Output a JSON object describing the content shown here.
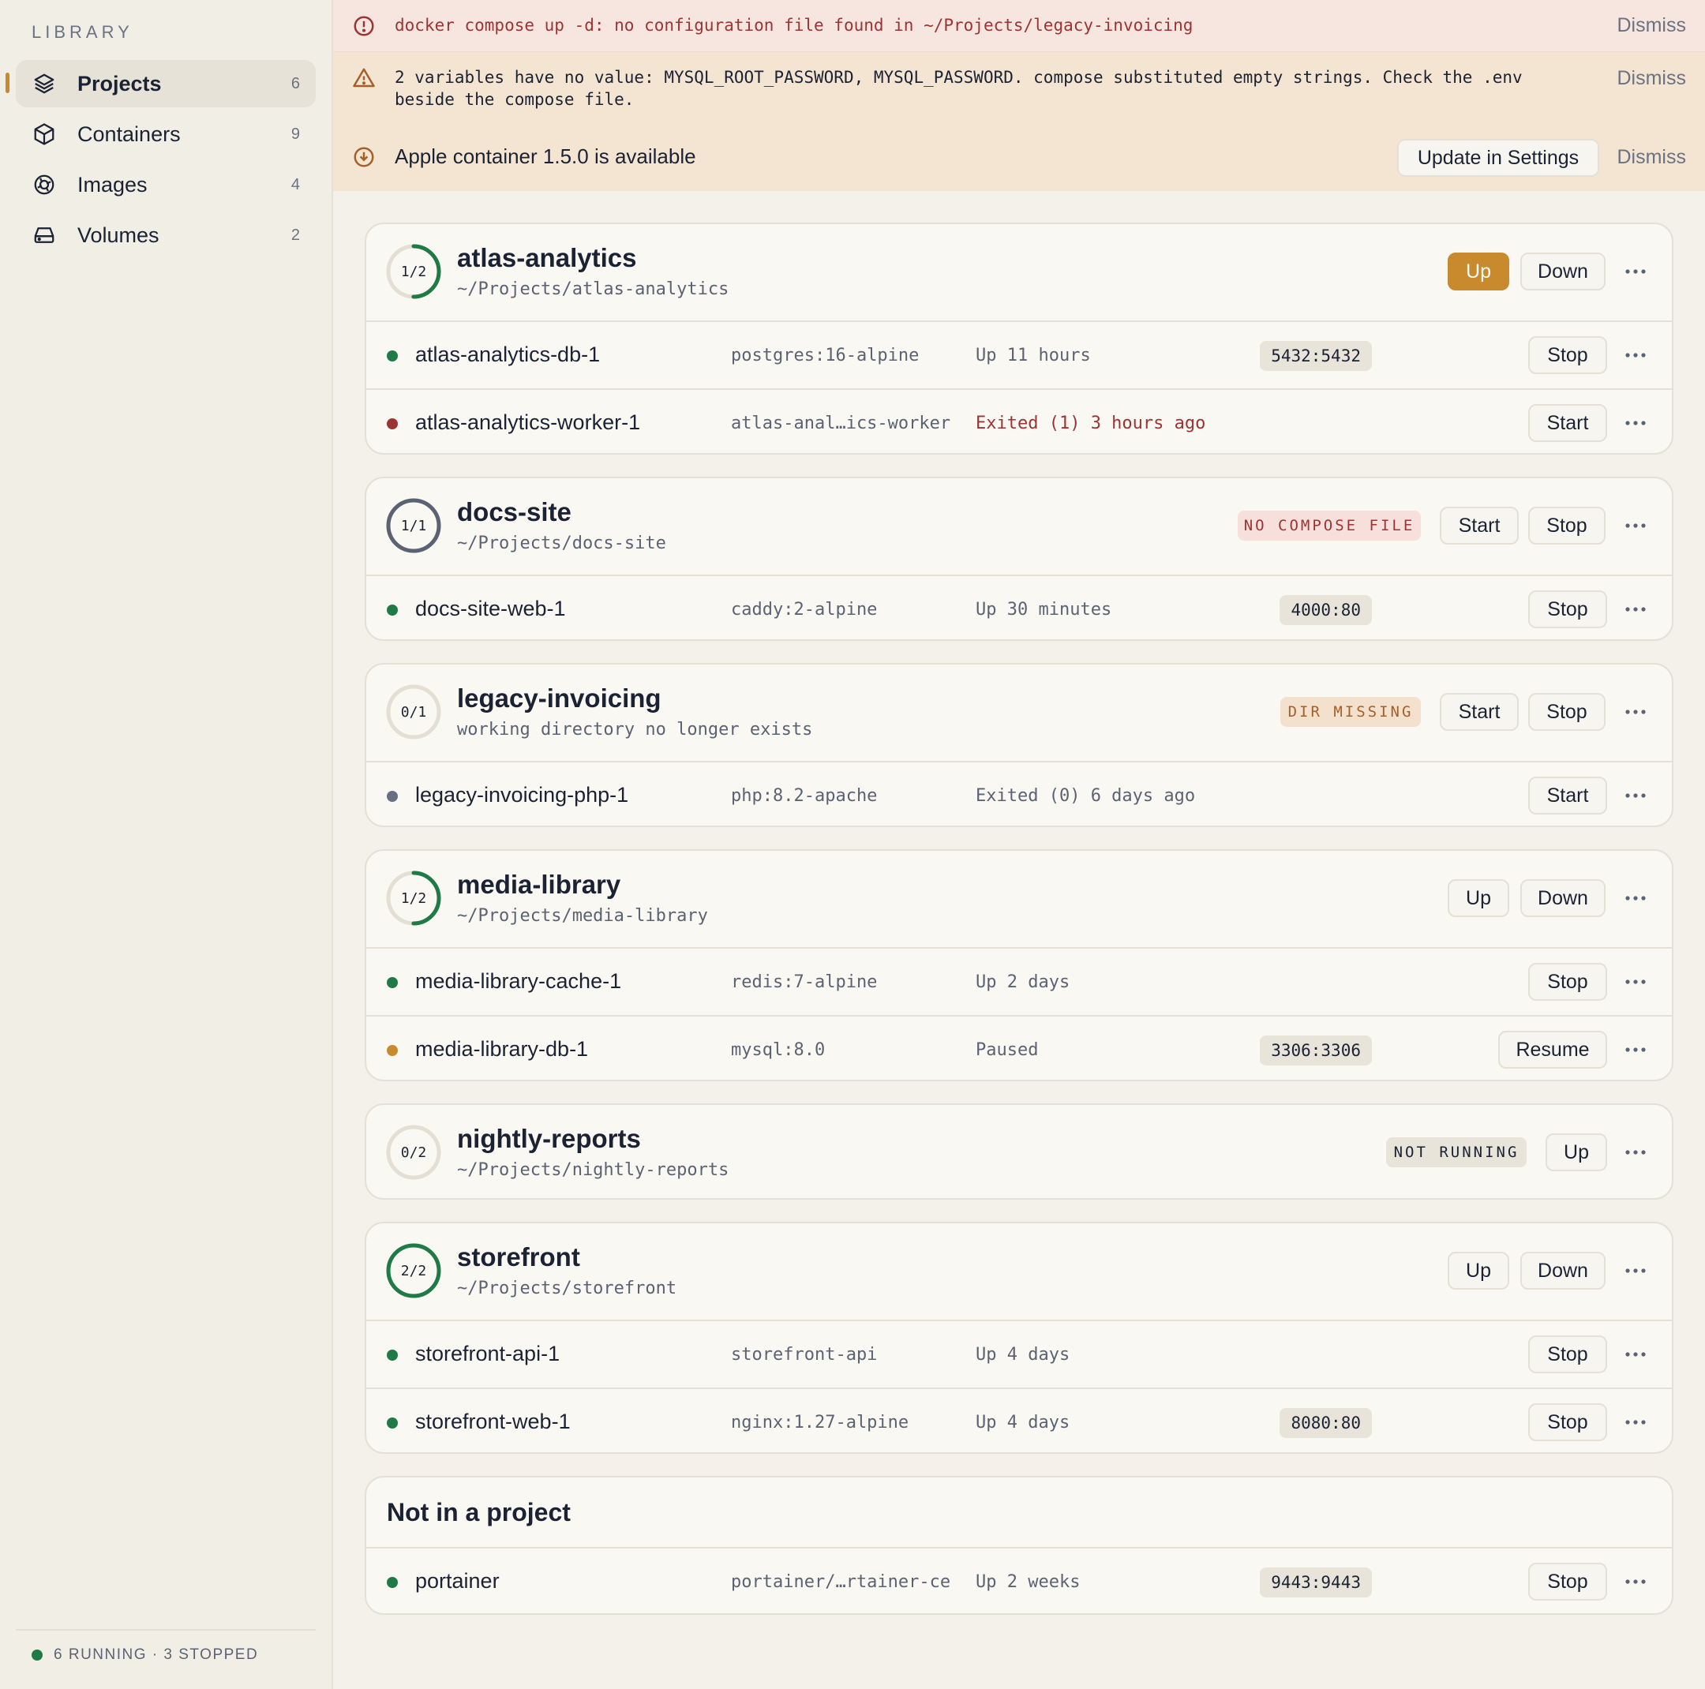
{
  "sidebar": {
    "heading": "LIBRARY",
    "items": [
      {
        "label": "Projects",
        "count": "6",
        "icon": "layers-icon"
      },
      {
        "label": "Containers",
        "count": "9",
        "icon": "box-icon"
      },
      {
        "label": "Images",
        "count": "4",
        "icon": "disc-icon"
      },
      {
        "label": "Volumes",
        "count": "2",
        "icon": "drive-icon"
      }
    ],
    "status": "6 RUNNING · 3 STOPPED"
  },
  "banners": {
    "error": {
      "text": "docker compose up -d: no configuration file found in ~/Projects/legacy-invoicing",
      "dismiss": "Dismiss"
    },
    "warning": {
      "text_line1": "2 variables have no value: MYSQL_ROOT_PASSWORD, MYSQL_PASSWORD. compose substituted empty strings. Check the .env",
      "text_line2": "beside the compose file.",
      "dismiss": "Dismiss"
    },
    "update": {
      "text": "Apple container 1.5.0 is available",
      "action": "Update in Settings",
      "dismiss": "Dismiss"
    }
  },
  "colors": {
    "accent": "#c98a2d",
    "running": "#1f7a46",
    "exited_error": "#9c3434",
    "stopped": "#667085",
    "paused": "#c98a2d"
  },
  "projects": [
    {
      "name": "atlas-analytics",
      "path": "~/Projects/atlas-analytics",
      "ratio": "1/2",
      "running_fraction": 0.5,
      "buttons": [
        "Up",
        "Down"
      ],
      "containers": [
        {
          "name": "atlas-analytics-db-1",
          "image": "postgres:16-alpine",
          "status": "Up 11 hours",
          "port": "5432:5432",
          "action": "Stop",
          "state": "running"
        },
        {
          "name": "atlas-analytics-worker-1",
          "image": "atlas-anal…ics-worker",
          "status": "Exited (1) 3 hours ago",
          "port": "",
          "action": "Start",
          "state": "error"
        }
      ]
    },
    {
      "name": "docs-site",
      "path": "~/Projects/docs-site",
      "ratio": "1/1",
      "running_fraction": 1.0,
      "badge": "NO COMPOSE FILE",
      "buttons": [
        "Start",
        "Stop"
      ],
      "containers": [
        {
          "name": "docs-site-web-1",
          "image": "caddy:2-alpine",
          "status": "Up 30 minutes",
          "port": "4000:80",
          "action": "Stop",
          "state": "running"
        }
      ]
    },
    {
      "name": "legacy-invoicing",
      "path": "working directory no longer exists",
      "ratio": "0/1",
      "running_fraction": 0,
      "badge": "DIR MISSING",
      "buttons": [
        "Start",
        "Stop"
      ],
      "containers": [
        {
          "name": "legacy-invoicing-php-1",
          "image": "php:8.2-apache",
          "status": "Exited (0) 6 days ago",
          "port": "",
          "action": "Start",
          "state": "stopped"
        }
      ]
    },
    {
      "name": "media-library",
      "path": "~/Projects/media-library",
      "ratio": "1/2",
      "running_fraction": 0.5,
      "buttons": [
        "Up",
        "Down"
      ],
      "containers": [
        {
          "name": "media-library-cache-1",
          "image": "redis:7-alpine",
          "status": "Up 2 days",
          "port": "",
          "action": "Stop",
          "state": "running"
        },
        {
          "name": "media-library-db-1",
          "image": "mysql:8.0",
          "status": "Paused",
          "port": "3306:3306",
          "action": "Resume",
          "state": "paused"
        }
      ]
    },
    {
      "name": "nightly-reports",
      "path": "~/Projects/nightly-reports",
      "ratio": "0/2",
      "running_fraction": 0,
      "badge": "NOT RUNNING",
      "buttons": [
        "Up"
      ],
      "containers": []
    },
    {
      "name": "storefront",
      "path": "~/Projects/storefront",
      "ratio": "2/2",
      "running_fraction": 1.0,
      "buttons": [
        "Up",
        "Down"
      ],
      "containers": [
        {
          "name": "storefront-api-1",
          "image": "storefront-api",
          "status": "Up 4 days",
          "port": "",
          "action": "Stop",
          "state": "running"
        },
        {
          "name": "storefront-web-1",
          "image": "nginx:1.27-alpine",
          "status": "Up 4 days",
          "port": "8080:80",
          "action": "Stop",
          "state": "running"
        }
      ]
    }
  ],
  "standalone": {
    "title": "Not in a project",
    "containers": [
      {
        "name": "portainer",
        "image": "portainer/…rtainer-ce",
        "status": "Up 2 weeks",
        "port": "9443:9443",
        "action": "Stop",
        "state": "running"
      }
    ]
  }
}
